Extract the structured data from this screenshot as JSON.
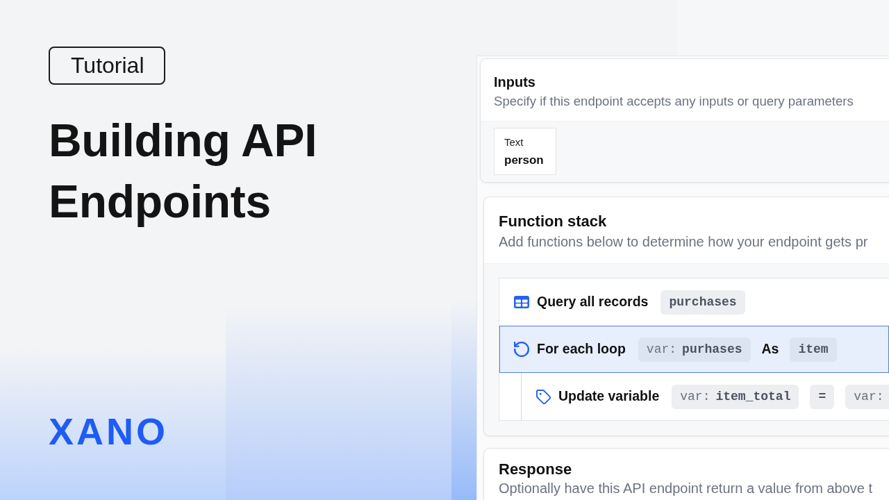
{
  "tag": "Tutorial",
  "title": "Building API Endpoints",
  "brand": "XANO",
  "editor": {
    "inputs": {
      "title": "Inputs",
      "subtitle": "Specify if this endpoint accepts any inputs or query parameters",
      "items": [
        {
          "type": "Text",
          "name": "person"
        }
      ]
    },
    "function_stack": {
      "title": "Function stack",
      "subtitle": "Add functions below to determine how your endpoint gets pr",
      "steps": [
        {
          "kind": "query",
          "title": "Query all records",
          "selected": false,
          "tokens": [
            {
              "kind": "chip",
              "text": "purchases"
            }
          ]
        },
        {
          "kind": "loop",
          "title": "For each loop",
          "selected": true,
          "tokens": [
            {
              "kind": "var",
              "prefix": "var:",
              "text": "purhases"
            },
            {
              "kind": "keyword",
              "text": "As"
            },
            {
              "kind": "chip",
              "text": "item"
            }
          ],
          "children": [
            {
              "kind": "update",
              "title": "Update variable",
              "selected": false,
              "tokens": [
                {
                  "kind": "var",
                  "prefix": "var:",
                  "text": "item_total"
                },
                {
                  "kind": "chip",
                  "text": "="
                },
                {
                  "kind": "var",
                  "prefix": "var:"
                }
              ]
            }
          ]
        }
      ]
    },
    "response": {
      "title": "Response",
      "subtitle": "Optionally have this API endpoint return a value from above t"
    }
  }
}
